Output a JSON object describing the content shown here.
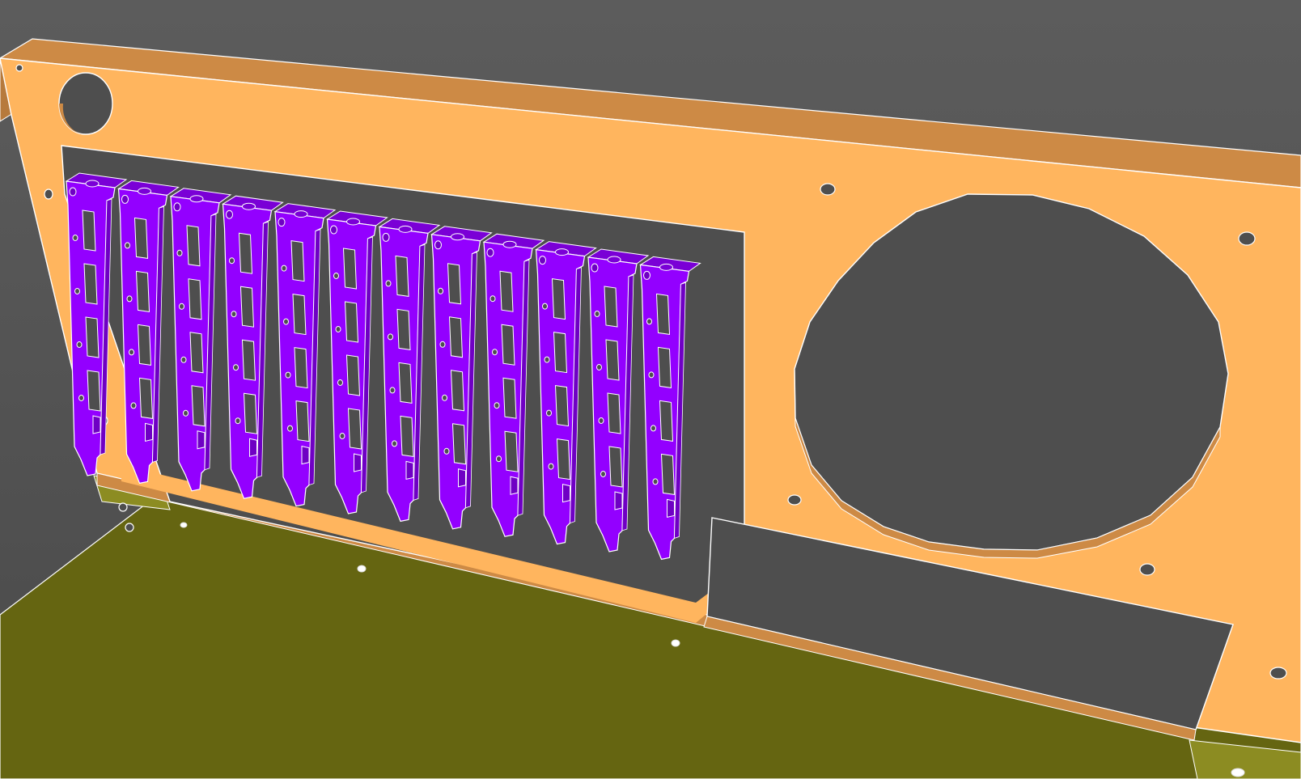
{
  "scene": {
    "kind": "cad-3d-view",
    "subject": "rear-panel-with-expansion-slot-brackets",
    "bracket_count": 12,
    "ports_per_bracket": 4,
    "colors": {
      "background_top": "#5c5c5c",
      "background_bottom": "#4a4a4a",
      "panel_face": "#ffb55e",
      "panel_top_edge": "#cd8a45",
      "panel_thickness": "#b77a3c",
      "opening": "#4e4e4e",
      "bracket": "#9300ff",
      "bracket_shade": "#6f00c4",
      "bracket_top": "#7a00d6",
      "base_plate": "#656511",
      "base_plate_side": "#8c8c22",
      "edge_line": "#ffffff"
    }
  }
}
